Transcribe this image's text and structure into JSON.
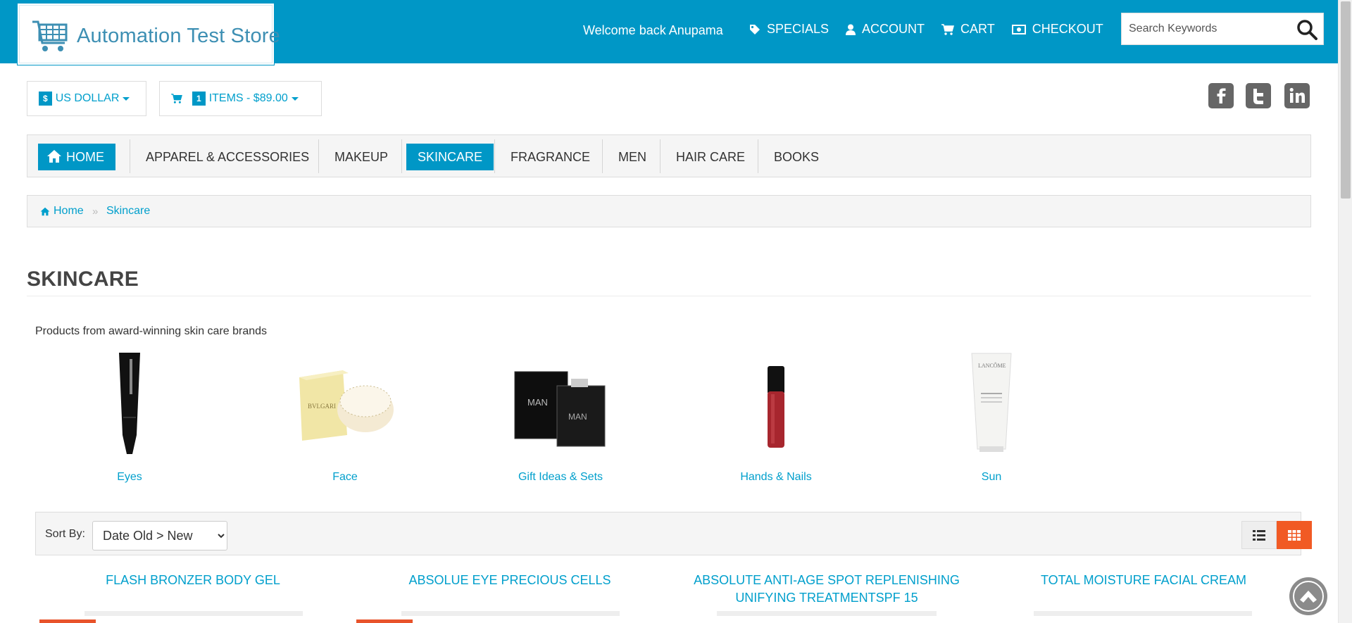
{
  "header": {
    "logo_text": "Automation Test Store",
    "welcome": "Welcome back Anupama",
    "nav": [
      {
        "label": "SPECIALS",
        "icon": "tag-icon"
      },
      {
        "label": "ACCOUNT",
        "icon": "user-icon"
      },
      {
        "label": "CART",
        "icon": "cart-icon"
      },
      {
        "label": "CHECKOUT",
        "icon": "money-icon"
      }
    ],
    "search_placeholder": "Search Keywords",
    "brand_color": "#0097c6"
  },
  "currency": {
    "symbol": "$",
    "label": "US DOLLAR"
  },
  "mini_cart": {
    "count": "1",
    "label": "ITEMS - $89.00"
  },
  "social": [
    "facebook-icon",
    "twitter-icon",
    "linkedin-icon"
  ],
  "categories": [
    {
      "label": "HOME",
      "active": true
    },
    {
      "label": "APPAREL & ACCESSORIES"
    },
    {
      "label": "MAKEUP"
    },
    {
      "label": "SKINCARE",
      "active": true
    },
    {
      "label": "FRAGRANCE"
    },
    {
      "label": "MEN"
    },
    {
      "label": "HAIR CARE"
    },
    {
      "label": "BOOKS"
    }
  ],
  "breadcrumb": [
    "Home",
    "Skincare"
  ],
  "page": {
    "title": "SKINCARE",
    "description": "Products from award-winning skin care brands"
  },
  "subcategories": [
    "Eyes",
    "Face",
    "Gift Ideas & Sets",
    "Hands & Nails",
    "Sun"
  ],
  "sort": {
    "label": "Sort By:",
    "selected": "Date Old > New"
  },
  "products": [
    "FLASH BRONZER BODY GEL",
    "ABSOLUE EYE PRECIOUS CELLS",
    "ABSOLUTE ANTI-AGE SPOT REPLENISHING UNIFYING TREATMENTSPF 15",
    "TOTAL MOISTURE FACIAL CREAM"
  ],
  "accent_color": "#f15a24"
}
